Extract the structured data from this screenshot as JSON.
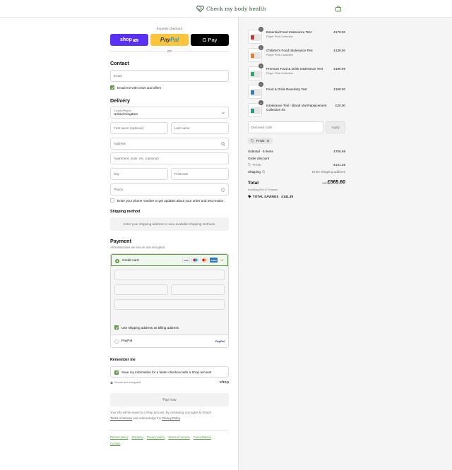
{
  "header": {
    "brand": "Check my body health",
    "cart_icon": "bag-icon"
  },
  "express": {
    "label": "Express checkout",
    "shop_pay": "shop",
    "shop_pay_pill": "Pay",
    "paypal_a": "Pay",
    "paypal_b": "Pal",
    "gpay": "G Pay",
    "or": "OR"
  },
  "contact": {
    "title": "Contact",
    "email_placeholder": "Email",
    "news_label": "Email me with news and offers"
  },
  "delivery": {
    "title": "Delivery",
    "country_label": "Country/Region",
    "country_value": "United Kingdom",
    "first_name": "First name (optional)",
    "last_name": "Last name",
    "address": "Address",
    "apartment": "Apartment, suite, etc. (optional)",
    "city": "City",
    "postcode": "Postcode",
    "phone": "Phone",
    "phone_updates": "Enter your phone number to get updates about your order and test results"
  },
  "shipping_method": {
    "title": "Shipping method",
    "notice": "Enter your shipping address to view available shipping methods."
  },
  "payment": {
    "title": "Payment",
    "subtitle": "All transactions are secure and encrypted.",
    "credit_card": "Credit card",
    "cards": [
      "VISA",
      "MC",
      "MC",
      "AMEX"
    ],
    "more_cards": "+4",
    "billing_same": "Use shipping address as billing address",
    "paypal": "PayPal",
    "paypal_logo": "PayPal"
  },
  "remember": {
    "title": "Remember me",
    "save_label": "Save my information for a faster checkout with a Shop account",
    "secure": "Secure and encrypted",
    "shop_word": "shop"
  },
  "pay_now": "Pay now",
  "legal": {
    "text_a": "Your info will be saved to a Shop account. By continuing, you agree to Shop's",
    "terms": "Terms of Service",
    "text_b": "and acknowledge the",
    "privacy": "Privacy Policy",
    "dot": "."
  },
  "footer_links": [
    "Refund policy",
    "Shipping",
    "Privacy policy",
    "Terms of service",
    "Cancellations",
    "Contact"
  ],
  "order": {
    "items": [
      {
        "qty": "1",
        "name": "Essential Food Intolerance Test",
        "sub": "Finger Prick Collection",
        "price": "£179.00",
        "color": "#c0392b"
      },
      {
        "qty": "1",
        "name": "Children's Food Intolerance Test",
        "sub": "Finger Prick Collection",
        "price": "£139.00",
        "color": "#e67e22"
      },
      {
        "qty": "1",
        "name": "Premium Food & Drink Intolerance Test",
        "sub": "Finger Prick Collection",
        "price": "£199.99",
        "color": "#27ae60"
      },
      {
        "qty": "1",
        "name": "Food & Drink Reactivity Test",
        "sub": "",
        "price": "£169.00",
        "color": "#2c7fb8"
      },
      {
        "qty": "1",
        "name": "Intolerance Test - Blood Vial Replacement Collection Kit",
        "sub": "",
        "price": "£20.00",
        "color": "#16a085"
      }
    ],
    "discount_placeholder": "Discount code",
    "apply": "Apply",
    "applied_code": "FIT20",
    "subtotal_label": "Subtotal · 5 items",
    "subtotal": "£706.99",
    "order_discount_label": "Order discount",
    "discount_code_label": "FIT20",
    "discount_value": "-£141.39",
    "shipping_label": "Shipping",
    "shipping_value": "Enter shipping address",
    "total_label": "Total",
    "currency": "GBP",
    "total": "£565.60",
    "taxes": "Including £94.27 in taxes",
    "savings_label": "TOTAL SAVINGS",
    "savings": "£141.39"
  }
}
